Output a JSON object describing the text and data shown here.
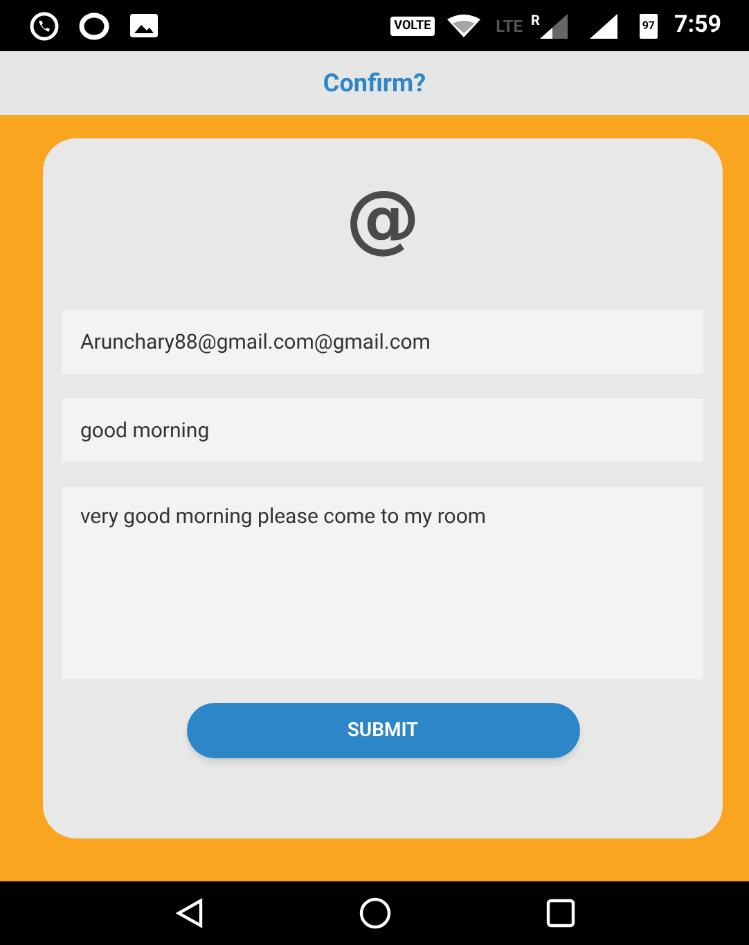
{
  "status_bar": {
    "volte": "VOLTE",
    "network": "LTE",
    "roaming": "R",
    "battery": "97",
    "time": "7:59"
  },
  "title": "Confirm?",
  "form": {
    "logo": "@",
    "fields": [
      {
        "kind": "input",
        "value": "Arunchary88@gmail.com@gmail.com"
      },
      {
        "kind": "input",
        "value": "good morning"
      },
      {
        "kind": "textarea",
        "value": "very good morning please come to my room"
      }
    ],
    "submit": "SUBMIT"
  }
}
